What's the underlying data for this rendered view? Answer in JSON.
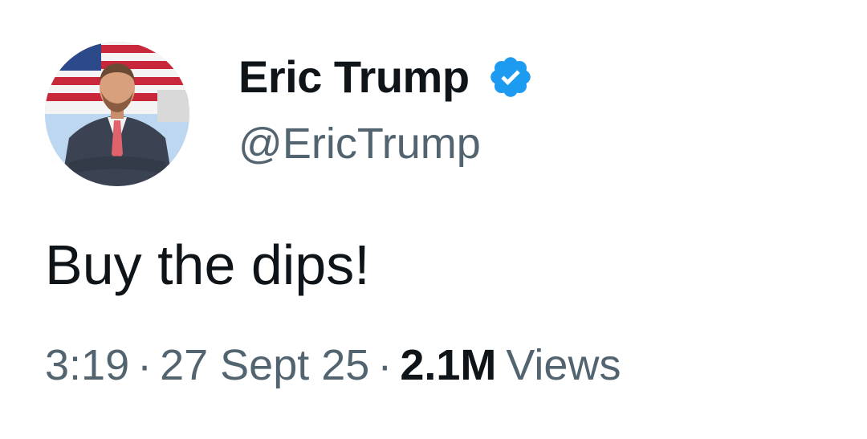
{
  "tweet": {
    "author": {
      "display_name": "Eric Trump",
      "handle": "@EricTrump",
      "verified": true,
      "verified_badge_icon": "verified-badge-icon",
      "badge_color": "#1d9bf0"
    },
    "text": "Buy the dips!",
    "meta": {
      "time": "3:19",
      "separator": "·",
      "date": "27 Sept 25",
      "views_count": "2.1M",
      "views_label": "Views"
    }
  },
  "colors": {
    "primary_text": "#0f1419",
    "secondary_text": "#536471",
    "background": "#ffffff"
  }
}
